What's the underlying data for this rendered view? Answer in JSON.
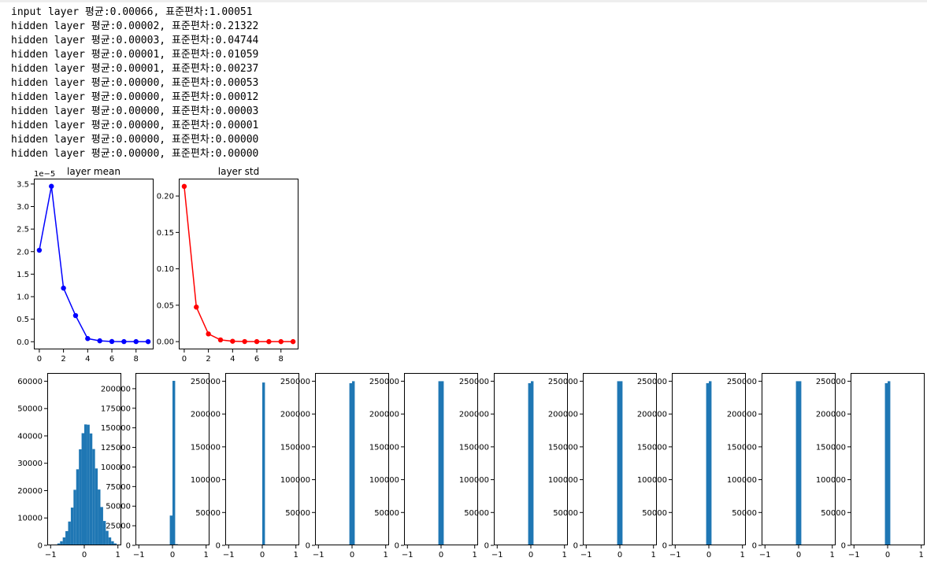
{
  "log_lines": [
    "input layer 평균:0.00066, 표준편차:1.00051",
    "hidden layer 평균:0.00002, 표준편차:0.21322",
    "hidden layer 평균:0.00003, 표준편차:0.04744",
    "hidden layer 평균:0.00001, 표준편차:0.01059",
    "hidden layer 평균:0.00001, 표준편차:0.00237",
    "hidden layer 평균:0.00000, 표준편차:0.00053",
    "hidden layer 평균:0.00000, 표준편차:0.00012",
    "hidden layer 평균:0.00000, 표준편차:0.00003",
    "hidden layer 평균:0.00000, 표준편차:0.00001",
    "hidden layer 평균:0.00000, 표준편차:0.00000",
    "hidden layer 평균:0.00000, 표준편차:0.00000"
  ],
  "colors": {
    "mean": "#0000ff",
    "std": "#ff0000",
    "hist": "#1f77b4"
  },
  "chart_data": [
    {
      "type": "line",
      "title": "layer mean",
      "x": [
        0,
        1,
        2,
        3,
        4,
        5,
        6,
        7,
        8,
        9
      ],
      "y": [
        2.03e-05,
        3.45e-05,
        1.19e-05,
        5.8e-06,
        7e-07,
        2e-07,
        5e-08,
        3e-08,
        3e-08,
        2e-08
      ],
      "xticks": [
        0,
        2,
        4,
        6,
        8
      ],
      "xtick_labels": [
        "0",
        "2",
        "4",
        "6",
        "8"
      ],
      "yticks": [
        0,
        5e-06,
        1e-05,
        1.5e-05,
        2e-05,
        2.5e-05,
        3e-05,
        3.5e-05
      ],
      "ytick_labels": [
        "0.0",
        "0.5",
        "1.0",
        "1.5",
        "2.0",
        "2.5",
        "3.0",
        "3.5"
      ],
      "offset_label": "1e−5",
      "xlim": [
        -0.45,
        9.45
      ],
      "ylim": [
        -1.7e-06,
        3.62e-05
      ],
      "marker": "circle",
      "color": "#0000ff"
    },
    {
      "type": "line",
      "title": "layer std",
      "x": [
        0,
        1,
        2,
        3,
        4,
        5,
        6,
        7,
        8,
        9
      ],
      "y": [
        0.21322,
        0.04744,
        0.01059,
        0.00237,
        0.00053,
        0.00012,
        3e-05,
        1e-05,
        0.0,
        0.0
      ],
      "xticks": [
        0,
        2,
        4,
        6,
        8
      ],
      "xtick_labels": [
        "0",
        "2",
        "4",
        "6",
        "8"
      ],
      "yticks": [
        0,
        0.05,
        0.1,
        0.15,
        0.2
      ],
      "ytick_labels": [
        "0.00",
        "0.05",
        "0.10",
        "0.15",
        "0.20"
      ],
      "xlim": [
        -0.45,
        9.45
      ],
      "ylim": [
        -0.01066,
        0.22388
      ],
      "marker": "circle",
      "color": "#ff0000"
    },
    {
      "type": "bar",
      "subtype": "histogram",
      "bins": [
        -0.92,
        -0.84,
        -0.76,
        -0.68,
        -0.6,
        -0.52,
        -0.44,
        -0.36,
        -0.28,
        -0.2,
        -0.12,
        -0.04,
        0.04,
        0.12,
        0.2,
        0.28,
        0.36,
        0.44,
        0.52,
        0.6,
        0.68,
        0.76,
        0.84,
        0.92
      ],
      "counts": [
        100,
        300,
        700,
        1500,
        2900,
        5200,
        8700,
        13800,
        20300,
        27800,
        35100,
        41000,
        44200,
        44100,
        40900,
        35200,
        28100,
        20400,
        14000,
        8900,
        5300,
        2900,
        1500,
        700
      ],
      "bin_width": 0.08,
      "xlim": [
        -1.1,
        1.1
      ],
      "ylim": [
        0,
        63000
      ],
      "xticks": [
        -1,
        0,
        1
      ],
      "xtick_labels": [
        "−1",
        "0",
        "1"
      ],
      "yticks": [
        0,
        10000,
        20000,
        30000,
        40000,
        50000,
        60000
      ],
      "ytick_labels": [
        "0",
        "10000",
        "20000",
        "30000",
        "40000",
        "50000",
        "60000"
      ],
      "color": "#1f77b4"
    },
    {
      "type": "bar",
      "subtype": "histogram",
      "bins": [
        -0.12,
        -0.04,
        0.04,
        0.12
      ],
      "counts": [
        500,
        38000,
        210000,
        1500
      ],
      "bin_width": 0.08,
      "xlim": [
        -1.1,
        1.1
      ],
      "ylim": [
        0,
        220000
      ],
      "xticks": [
        -1,
        0,
        1
      ],
      "xtick_labels": [
        "−1",
        "0",
        "1"
      ],
      "yticks": [
        0,
        25000,
        50000,
        75000,
        100000,
        125000,
        150000,
        175000,
        200000
      ],
      "ytick_labels": [
        "0",
        "25000",
        "50000",
        "75000",
        "100000",
        "125000",
        "150000",
        "175000",
        "200000"
      ],
      "color": "#1f77b4"
    },
    {
      "type": "bar",
      "subtype": "histogram",
      "bins": [
        -0.04,
        0.04
      ],
      "counts": [
        1000,
        248000
      ],
      "bin_width": 0.08,
      "xlim": [
        -1.1,
        1.1
      ],
      "ylim": [
        0,
        262500
      ],
      "xticks": [
        -1,
        0,
        1
      ],
      "xtick_labels": [
        "−1",
        "0",
        "1"
      ],
      "yticks": [
        0,
        50000,
        100000,
        150000,
        200000,
        250000
      ],
      "ytick_labels": [
        "0",
        "50000",
        "100000",
        "150000",
        "200000",
        "250000"
      ],
      "color": "#1f77b4"
    },
    {
      "type": "bar",
      "subtype": "histogram",
      "bins": [
        -0.04,
        0.04
      ],
      "counts": [
        247000,
        250000
      ],
      "bin_width": 0.08,
      "xlim": [
        -1.1,
        1.1
      ],
      "ylim": [
        0,
        262500
      ],
      "xticks": [
        -1,
        0,
        1
      ],
      "xtick_labels": [
        "−1",
        "0",
        "1"
      ],
      "yticks": [
        0,
        50000,
        100000,
        150000,
        200000,
        250000
      ],
      "ytick_labels": [
        "0",
        "50000",
        "100000",
        "150000",
        "200000",
        "250000"
      ],
      "color": "#1f77b4"
    },
    {
      "type": "bar",
      "subtype": "histogram",
      "bins": [
        -0.04,
        0.04
      ],
      "counts": [
        250000,
        250000
      ],
      "bin_width": 0.08,
      "xlim": [
        -1.1,
        1.1
      ],
      "ylim": [
        0,
        262500
      ],
      "xticks": [
        -1,
        0,
        1
      ],
      "xtick_labels": [
        "−1",
        "0",
        "1"
      ],
      "yticks": [
        0,
        50000,
        100000,
        150000,
        200000,
        250000
      ],
      "ytick_labels": [
        "0",
        "50000",
        "100000",
        "150000",
        "200000",
        "250000"
      ],
      "color": "#1f77b4"
    },
    {
      "type": "bar",
      "subtype": "histogram",
      "bins": [
        -0.04,
        0.04
      ],
      "counts": [
        247000,
        250000
      ],
      "bin_width": 0.08,
      "xlim": [
        -1.1,
        1.1
      ],
      "ylim": [
        0,
        262500
      ],
      "xticks": [
        -1,
        0,
        1
      ],
      "xtick_labels": [
        "−1",
        "0",
        "1"
      ],
      "yticks": [
        0,
        50000,
        100000,
        150000,
        200000,
        250000
      ],
      "ytick_labels": [
        "0",
        "50000",
        "100000",
        "150000",
        "200000",
        "250000"
      ],
      "color": "#1f77b4"
    },
    {
      "type": "bar",
      "subtype": "histogram",
      "bins": [
        -0.04,
        0.04
      ],
      "counts": [
        250000,
        250000
      ],
      "bin_width": 0.08,
      "xlim": [
        -1.1,
        1.1
      ],
      "ylim": [
        0,
        262500
      ],
      "xticks": [
        -1,
        0,
        1
      ],
      "xtick_labels": [
        "−1",
        "0",
        "1"
      ],
      "yticks": [
        0,
        50000,
        100000,
        150000,
        200000,
        250000
      ],
      "ytick_labels": [
        "0",
        "50000",
        "100000",
        "150000",
        "200000",
        "250000"
      ],
      "color": "#1f77b4"
    },
    {
      "type": "bar",
      "subtype": "histogram",
      "bins": [
        -0.04,
        0.04
      ],
      "counts": [
        247000,
        250000
      ],
      "bin_width": 0.08,
      "xlim": [
        -1.1,
        1.1
      ],
      "ylim": [
        0,
        262500
      ],
      "xticks": [
        -1,
        0,
        1
      ],
      "xtick_labels": [
        "−1",
        "0",
        "1"
      ],
      "yticks": [
        0,
        50000,
        100000,
        150000,
        200000,
        250000
      ],
      "ytick_labels": [
        "0",
        "50000",
        "100000",
        "150000",
        "200000",
        "250000"
      ],
      "color": "#1f77b4"
    },
    {
      "type": "bar",
      "subtype": "histogram",
      "bins": [
        -0.04,
        0.04
      ],
      "counts": [
        250000,
        250000
      ],
      "bin_width": 0.08,
      "xlim": [
        -1.1,
        1.1
      ],
      "ylim": [
        0,
        262500
      ],
      "xticks": [
        -1,
        0,
        1
      ],
      "xtick_labels": [
        "−1",
        "0",
        "1"
      ],
      "yticks": [
        0,
        50000,
        100000,
        150000,
        200000,
        250000
      ],
      "ytick_labels": [
        "0",
        "50000",
        "100000",
        "150000",
        "200000",
        "250000"
      ],
      "color": "#1f77b4"
    },
    {
      "type": "bar",
      "subtype": "histogram",
      "bins": [
        -0.04,
        0.04
      ],
      "counts": [
        247000,
        250000
      ],
      "bin_width": 0.08,
      "xlim": [
        -1.1,
        1.1
      ],
      "ylim": [
        0,
        262500
      ],
      "xticks": [
        -1,
        0,
        1
      ],
      "xtick_labels": [
        "−1",
        "0",
        "1"
      ],
      "yticks": [
        0,
        50000,
        100000,
        150000,
        200000,
        250000
      ],
      "ytick_labels": [
        "0",
        "50000",
        "100000",
        "150000",
        "200000",
        "250000"
      ],
      "color": "#1f77b4"
    }
  ]
}
